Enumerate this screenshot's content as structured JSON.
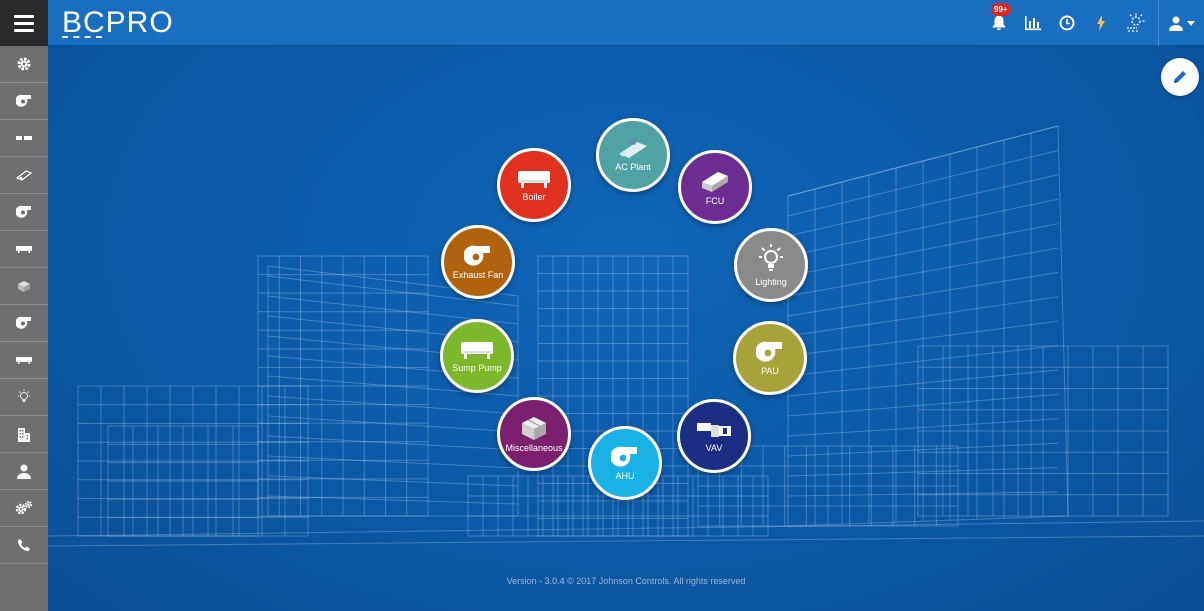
{
  "app": {
    "logo_text": "BCPRO"
  },
  "topbar": {
    "notification_badge": "99+",
    "icons": [
      "bell-icon",
      "bar-chart-icon",
      "clock-icon",
      "bolt-icon",
      "weather-icon",
      "user-icon",
      "caret-down-icon"
    ]
  },
  "sidebar": {
    "items": [
      "gear-icon",
      "fan-icon",
      "fcu-icon",
      "ac-plant-icon",
      "fan-icon",
      "boiler-icon",
      "cube-icon",
      "fan-icon",
      "boiler-icon",
      "bulb-icon",
      "building-icon",
      "user-icon",
      "gears-icon",
      "phone-icon"
    ]
  },
  "categories": [
    {
      "id": "ac-plant",
      "label": "AC Plant",
      "color": "#4fa3a5",
      "icon": "ac-plant-icon"
    },
    {
      "id": "fcu",
      "label": "FCU",
      "color": "#6c2c91",
      "icon": "fcu-icon"
    },
    {
      "id": "lighting",
      "label": "Lighting",
      "color": "#8a8a8a",
      "icon": "bulb-icon"
    },
    {
      "id": "pau",
      "label": "PAU",
      "color": "#a8a23a",
      "icon": "fan-icon"
    },
    {
      "id": "vav",
      "label": "VAV",
      "color": "#1c2d84",
      "icon": "vav-icon"
    },
    {
      "id": "ahu",
      "label": "AHU",
      "color": "#1ab1e4",
      "icon": "fan-icon"
    },
    {
      "id": "miscellaneous",
      "label": "Miscellaneous",
      "color": "#7b1f6e",
      "icon": "cube-icon"
    },
    {
      "id": "sump-pump",
      "label": "Sump Pump",
      "color": "#7cb82b",
      "icon": "boiler-icon"
    },
    {
      "id": "exhaust-fan",
      "label": "Exhaust Fan",
      "color": "#b0620f",
      "icon": "fan-icon"
    },
    {
      "id": "boiler",
      "label": "Boiler",
      "color": "#e0321e",
      "icon": "boiler-icon"
    }
  ],
  "footer": {
    "text": "Version - 3.0.4 © 2017 Johnson Controls. All rights reserved"
  }
}
